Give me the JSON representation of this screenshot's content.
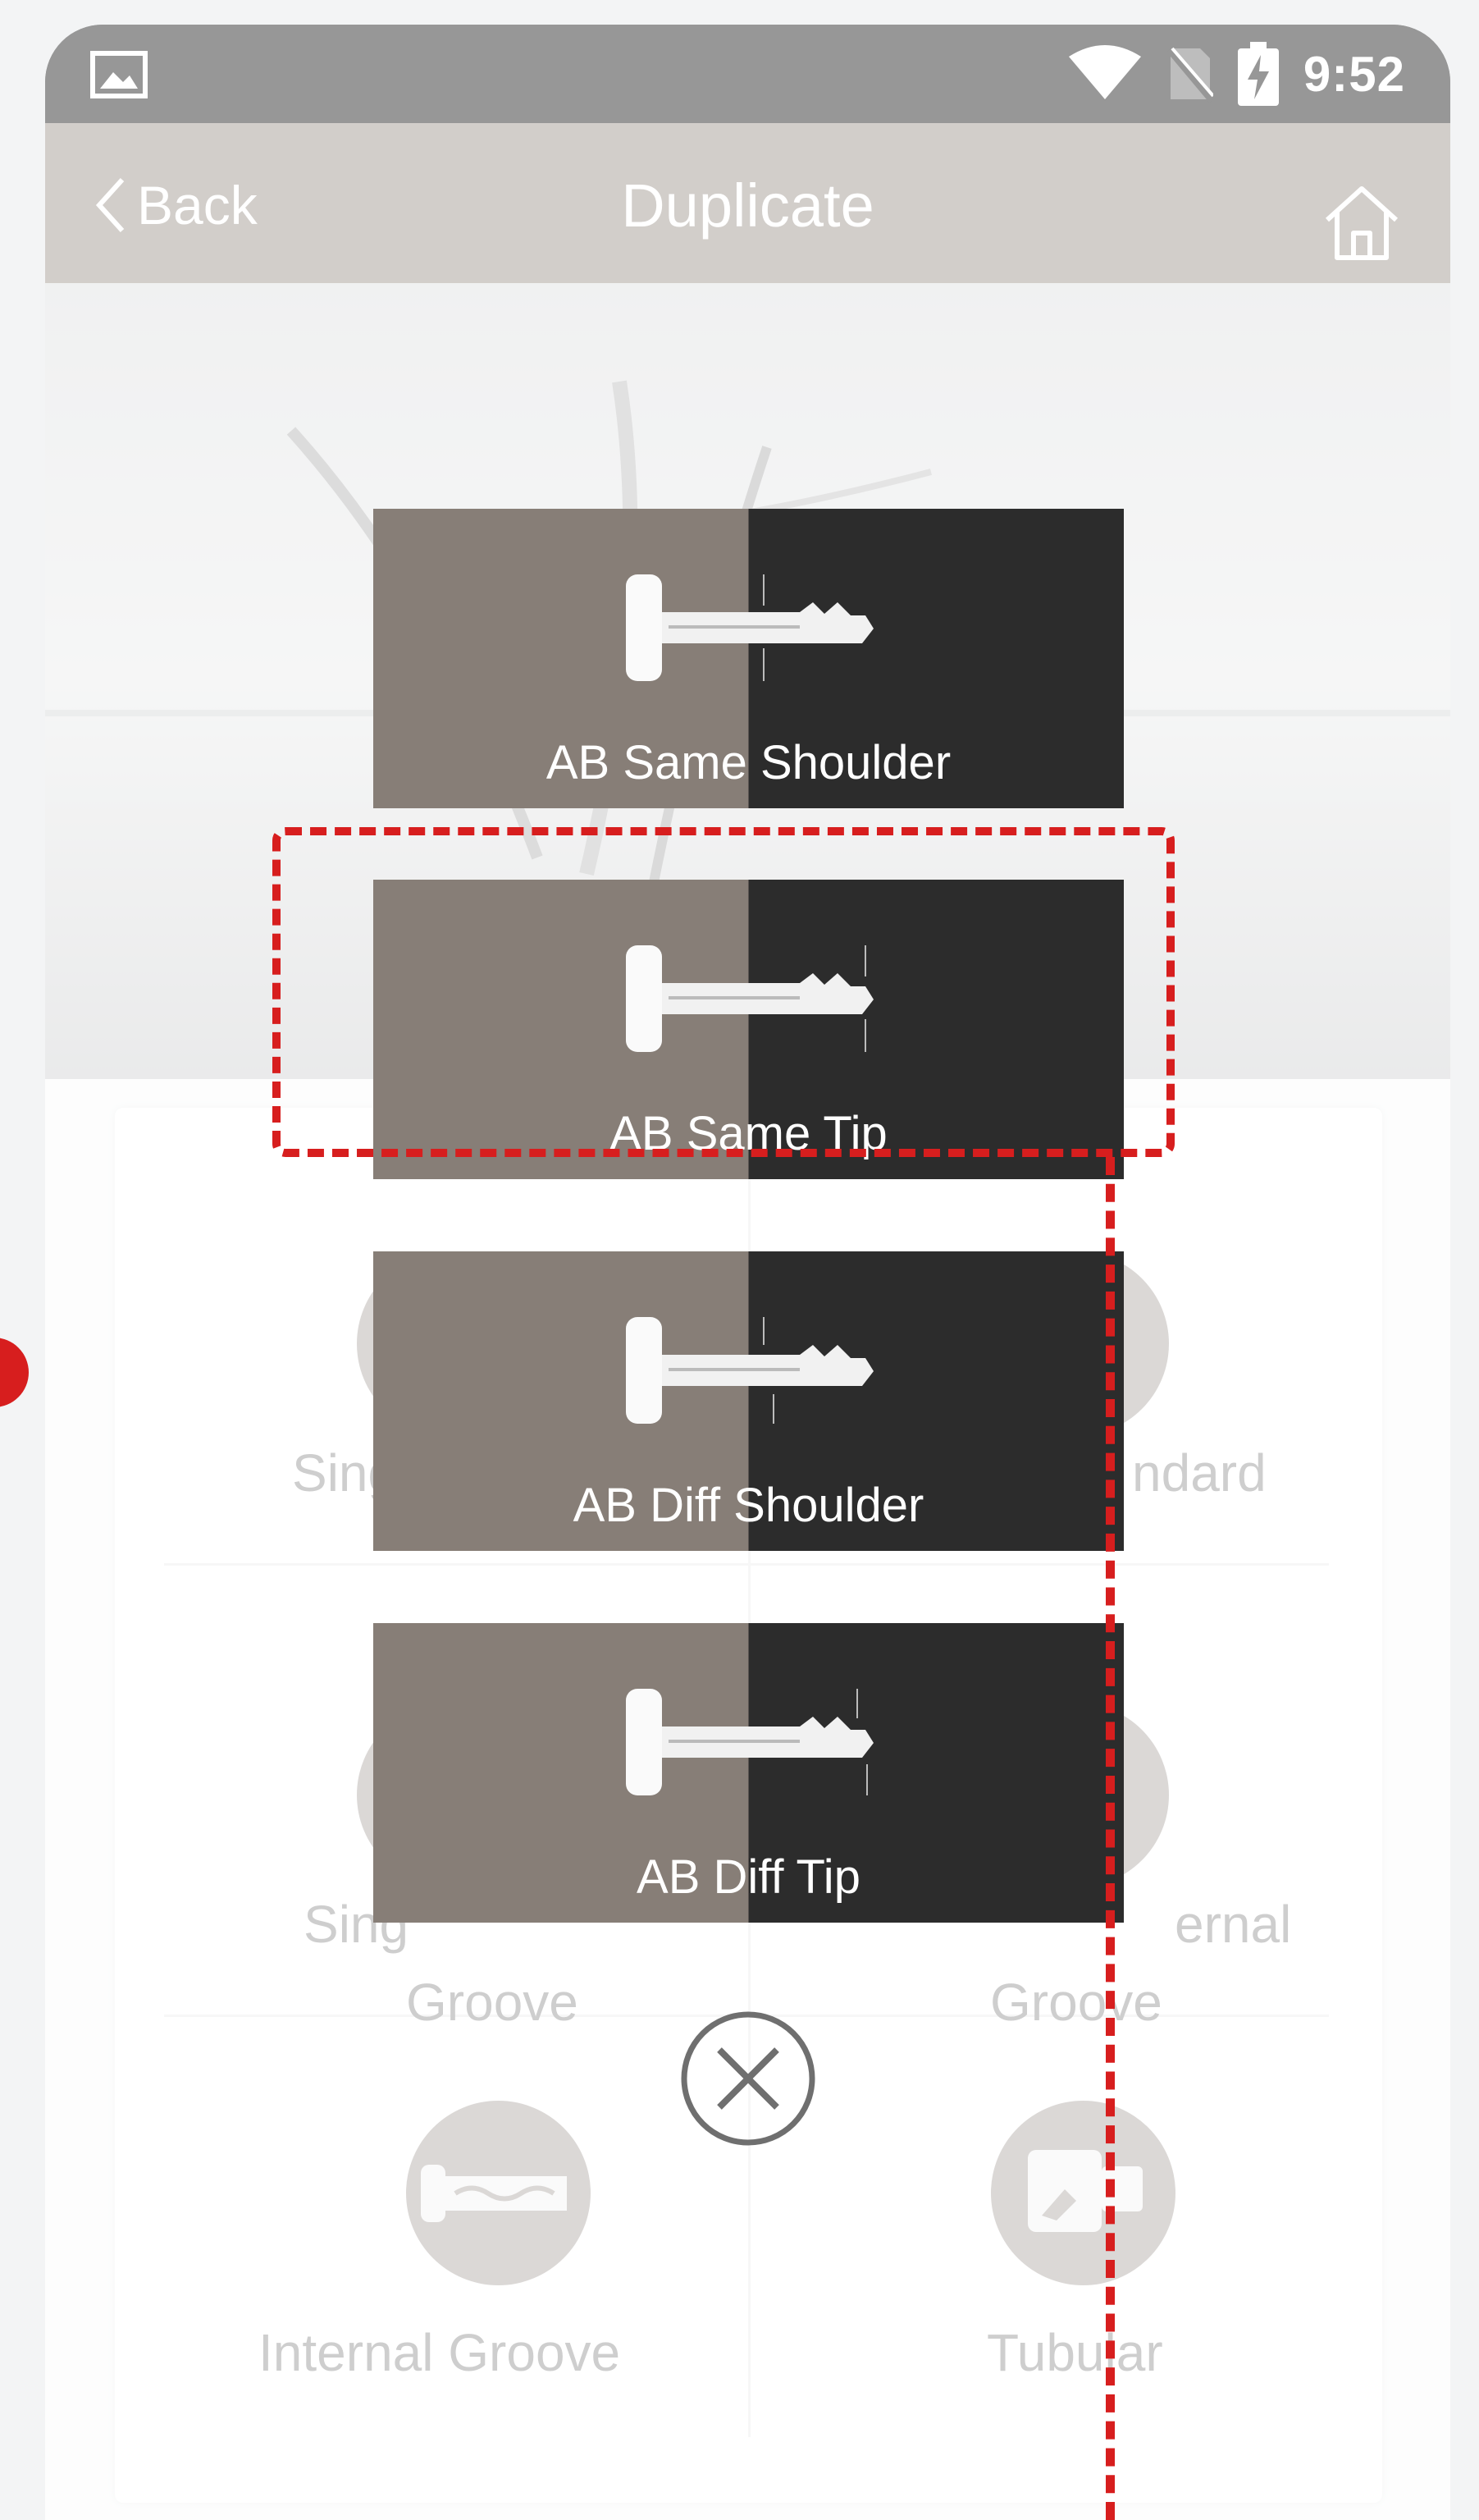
{
  "status_bar": {
    "time": "9:52"
  },
  "app_bar": {
    "back_label": "Back",
    "title": "Duplicate"
  },
  "key_types": [
    {
      "label": "Single Standard"
    },
    {
      "label": "Double Standard"
    },
    {
      "label": "Single Internal Groove"
    },
    {
      "label": "Double Internal Groove"
    },
    {
      "label": "Internal Groove"
    },
    {
      "label": "Tubular"
    }
  ],
  "key_types_visible": {
    "row1_left": "Singl",
    "row1_right": "ndard",
    "row2_left_line1": "Sing",
    "row2_left_line2": "Groove",
    "row2_right_line1": "ernal",
    "row2_right_line2": "Groove",
    "row3_left": "Internal Groove",
    "row3_right": "Tubular"
  },
  "options": [
    {
      "label": "AB Same Shoulder"
    },
    {
      "label": "AB Same Tip"
    },
    {
      "label": "AB Diff Shoulder"
    },
    {
      "label": "AB Diff Tip"
    }
  ],
  "annotation": {
    "highlighted_option": "AB Same Tip",
    "color": "#d71e1e"
  },
  "colors": {
    "app_bar": "#a49c95",
    "status_bar": "#2e2e2e",
    "option_left": "#877e77",
    "option_right": "#2c2c2c",
    "accent_red": "#d71e1e"
  },
  "icons": [
    "image-icon",
    "wifi-icon",
    "no-sim-icon",
    "battery-charging-icon",
    "chevron-left-icon",
    "home-icon",
    "key-icon",
    "close-icon"
  ]
}
